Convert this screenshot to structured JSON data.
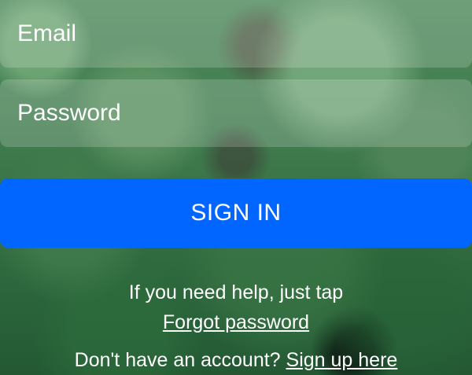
{
  "form": {
    "email_placeholder": "Email",
    "password_placeholder": "Password",
    "signin_label": "SIGN IN"
  },
  "help": {
    "text": "If you need help, just tap",
    "forgot_label": "Forgot password"
  },
  "signup": {
    "prompt": "Don't have an account?",
    "link_label": "Sign up here"
  },
  "colors": {
    "accent": "#0066ff",
    "text": "#ffffff"
  }
}
